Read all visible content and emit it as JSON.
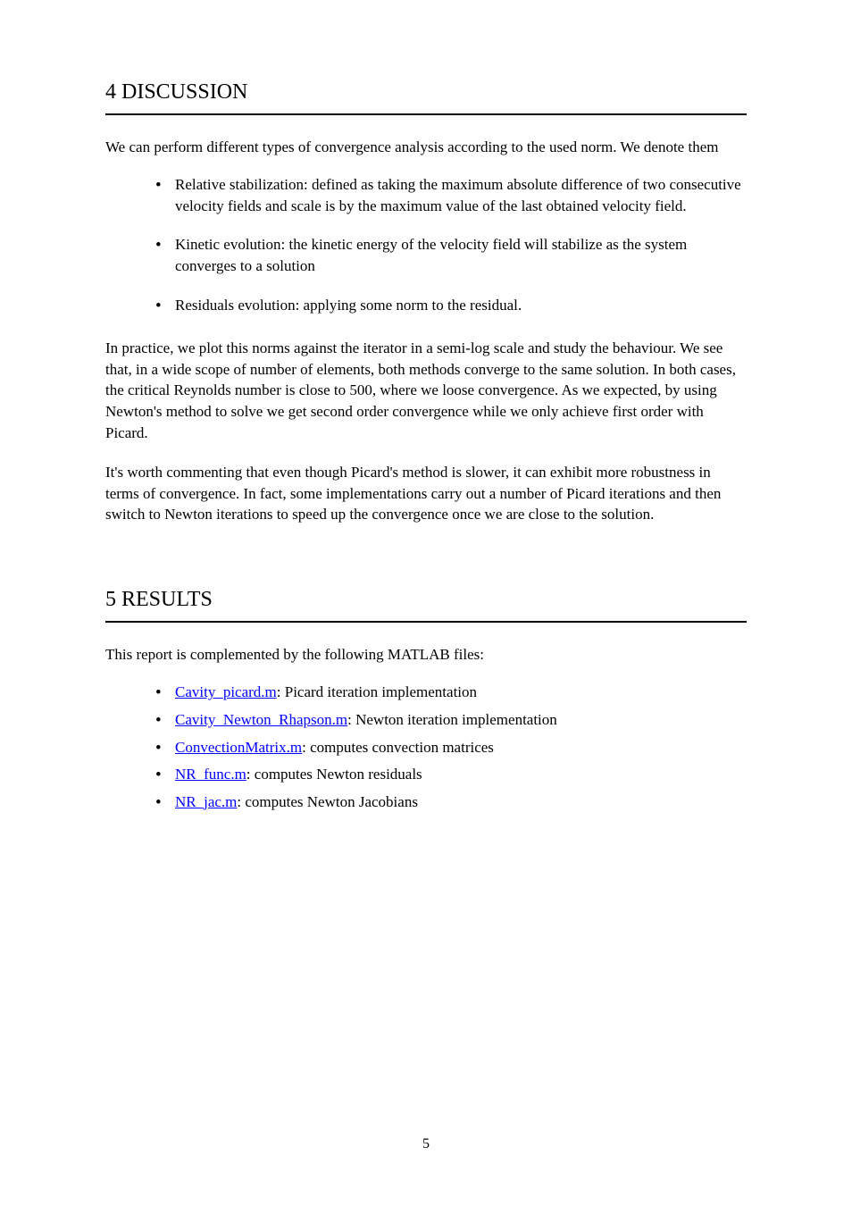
{
  "section1": {
    "heading": "4 DISCUSSION",
    "intro": "We can perform different types of convergence analysis according to the used norm. We denote them",
    "bullets": [
      "Relative stabilization: defined as taking the maximum absolute difference of two consecutive velocity fields and scale is by the maximum value of the last obtained velocity field.",
      "Kinetic evolution: the kinetic energy of the velocity field will stabilize as the system converges to a solution",
      "Residuals evolution: applying some norm to the residual."
    ],
    "para1": "In practice, we plot this norms against the iterator in a semi-log scale and study the behaviour. We see that, in a wide scope of number of elements, both methods converge to the same solution. In both cases, the critical Reynolds number is close to 500, where we loose convergence. As we expected, by using Newton's method to solve we get second order convergence while we only achieve first order with Picard.",
    "para2": "It's worth commenting that even though Picard's method is slower, it can exhibit more robustness in terms of convergence. In fact, some implementations carry out a number of Picard iterations and then switch to Newton iterations to speed up the convergence once we are close to the solution."
  },
  "section2": {
    "heading": "5 RESULTS",
    "intro": "This report is complemented by the following MATLAB files:",
    "items": [
      {
        "label": "Cavity_picard.m",
        "rest": ": Picard iteration implementation"
      },
      {
        "label": "Cavity_Newton_Rhapson.m",
        "rest": ": Newton iteration implementation"
      },
      {
        "label": "ConvectionMatrix.m",
        "rest": ": computes convection matrices"
      },
      {
        "label": "NR_func.m",
        "rest": ": computes Newton residuals"
      },
      {
        "label": "NR_jac.m",
        "rest": ": computes Newton Jacobians"
      }
    ]
  },
  "pageNumber": "5"
}
